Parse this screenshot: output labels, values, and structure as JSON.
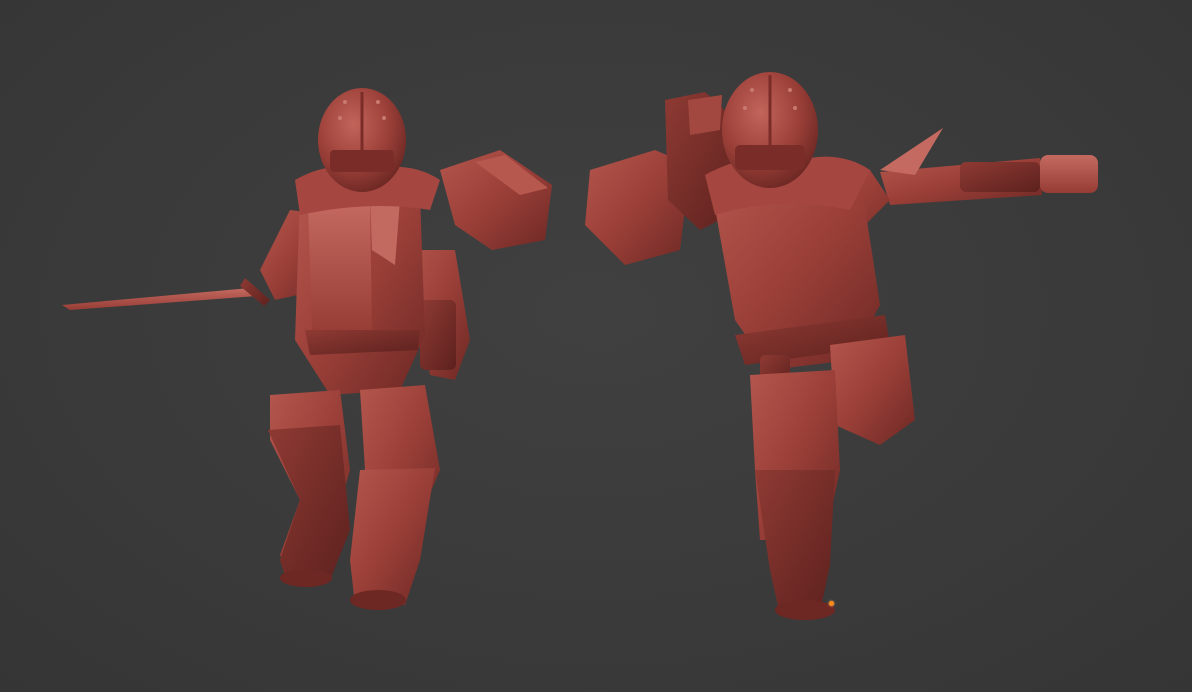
{
  "viewport": {
    "background": "#3a3a3a",
    "model_color": "#9a3f38"
  },
  "models": [
    {
      "name": "miniature-left",
      "weapon": "sword",
      "pose": "advancing"
    },
    {
      "name": "miniature-right",
      "weapon": "pistol-and-knife",
      "pose": "lunging"
    }
  ],
  "origin_marker": {
    "color": "#ff8a1c"
  }
}
